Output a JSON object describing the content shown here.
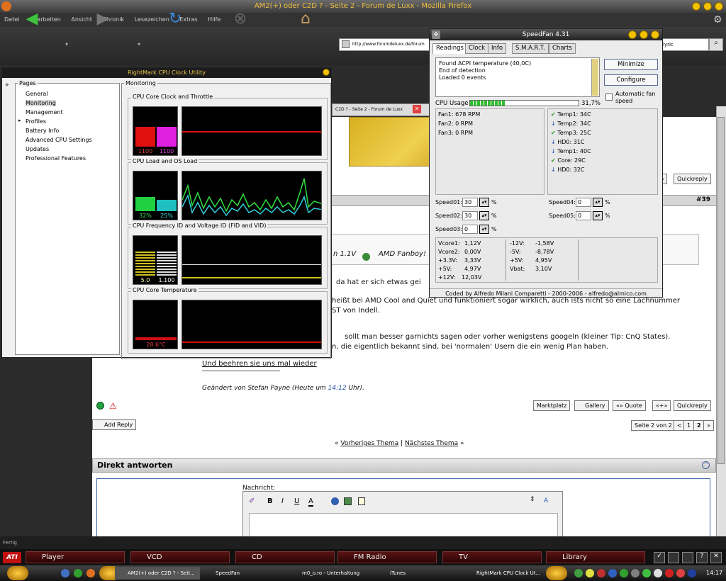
{
  "firefox": {
    "title": "AM2(+) oder C2D ? - Seite 2 - Forum de Luxx - Mozilla Firefox",
    "menu": [
      "Datei",
      "Bearbeiten",
      "Ansicht",
      "Chronik",
      "Lesezeichen",
      "Extras",
      "Hilfe"
    ],
    "url": "http://www.forumdeluxx.de/forum",
    "search_value": "lyric",
    "tab_title": "C2D ? - Seite 2 - Forum de Luxx",
    "status": "Fertig"
  },
  "forum": {
    "post_number": "#39",
    "buttons_top": [
      "Quickreply"
    ],
    "text_lines": [
      "n 1.1V",
      "AMD Fanboy!",
      "da hat er sich etwas gei",
      "heißt bei AMD Cool and Quiet und funktioniert sogar wirklich, auch ists nicht so eine Lachnummer",
      "ST von Indell.",
      "sollt man besser garnichts sagen oder vorher wenigstens googeln (kleiner Tip: CnQ States).",
      "n, die eigentlich bekannt sind, bei 'normalen' Usern die ein wenig Plan haben."
    ],
    "signature": "Und beehren sie uns mal wieder",
    "edited_prefix": "Geändert von Stefan Payne (Heute um ",
    "edited_time": "14:12",
    "edited_suffix": " Uhr).",
    "post_buttons": [
      "Marktplatz",
      "Gallery",
      "Quote",
      "Quickreply"
    ],
    "add_reply": "Add Reply",
    "pagination": {
      "label": "Seite 2 von 2",
      "prev": "<",
      "pages": [
        "1",
        "2"
      ]
    },
    "thread_nav": {
      "prev": "Vorheriges Thema",
      "sep": "|",
      "next": "Nächstes Thema"
    },
    "direct_reply": "Direkt antworten",
    "message_label": "Nachricht:"
  },
  "rightmark": {
    "title": "RightMark CPU Clock Utility",
    "pages_label": "Pages",
    "monitoring_label": "Monitoring",
    "nav": [
      "General",
      "Monitoring",
      "Management",
      "Profiles",
      "Battery Info",
      "Advanced CPU Settings",
      "Updates",
      "Professional Features"
    ],
    "groups": [
      {
        "label": "CPU Core Clock and Throttle",
        "values": [
          "1100",
          "1100"
        ],
        "colors": [
          "#e01010",
          "#e020e0"
        ],
        "fill": [
          0.45,
          0.45
        ]
      },
      {
        "label": "CPU Load and OS Load",
        "values": [
          "32%",
          "25%"
        ],
        "colors": [
          "#20d040",
          "#20c0c0"
        ],
        "fill": [
          0.32,
          0.25
        ]
      },
      {
        "label": "CPU Frequency ID and Voltage ID (FID and VID)",
        "values": [
          "5.0",
          "1.100"
        ],
        "colors": [
          "#d0c020",
          "#e0e0e0"
        ],
        "fill": [
          0.55,
          0.55
        ]
      },
      {
        "label": "CPU Core Temperature",
        "values": [
          "28.6°C"
        ],
        "colors": [
          "#d01010"
        ],
        "fill": [
          0.2
        ]
      }
    ]
  },
  "speedfan": {
    "title": "SpeedFan 4.31",
    "tabs": [
      "Readings",
      "Clock",
      "Info",
      "S.M.A.R.T.",
      "Charts"
    ],
    "log": [
      "Found ACPI temperature (40,0C)",
      "End of detection",
      "Loaded 0 events"
    ],
    "buttons": {
      "minimize": "Minimize",
      "configure": "Configure"
    },
    "auto_fan": "Automatic fan speed",
    "cpu_usage_label": "CPU Usage",
    "cpu_usage_value": "31,7%",
    "cpu_usage_fraction": 0.317,
    "fans": [
      "Fan1: 678 RPM",
      "Fan2: 0 RPM",
      "Fan3: 0 RPM"
    ],
    "temps": [
      {
        "label": "Temp1: 34C",
        "status": "check"
      },
      {
        "label": "Temp2: 34C",
        "status": "down"
      },
      {
        "label": "Temp3: 25C",
        "status": "check"
      },
      {
        "label": "HD0:   31C",
        "status": "down"
      },
      {
        "label": "Temp1: 40C",
        "status": "down"
      },
      {
        "label": "Core:  29C",
        "status": "check"
      },
      {
        "label": "HD0:   32C",
        "status": "down"
      }
    ],
    "speeds": [
      {
        "label": "Speed01:",
        "value": "30"
      },
      {
        "label": "Speed02:",
        "value": "30"
      },
      {
        "label": "Speed03:",
        "value": "0"
      },
      {
        "label": "Speed04:",
        "value": "0"
      },
      {
        "label": "Speed05:",
        "value": "0"
      }
    ],
    "percent": "%",
    "volts_left": [
      [
        "Vcore1:",
        "1,12V"
      ],
      [
        "Vcore2:",
        "0,00V"
      ],
      [
        "+3.3V:",
        "3,33V"
      ],
      [
        "+5V:",
        "4,97V"
      ],
      [
        "+12V:",
        "12,03V"
      ]
    ],
    "volts_right": [
      [
        "-12V:",
        "-1,58V"
      ],
      [
        "-5V:",
        "-8,78V"
      ],
      [
        "+5V:",
        "4,95V"
      ],
      [
        "Vbat:",
        "3,10V"
      ]
    ],
    "credits": "Coded by Alfredo Milani Comparetti - 2000-2006 - alfredo@almico.com"
  },
  "media_bar": {
    "logo": "ATI",
    "items": [
      "Player",
      "VCD",
      "CD",
      "FM Radio",
      "TV",
      "Library"
    ]
  },
  "taskbar": {
    "items": [
      "AM2(+) oder C2D ? - Seit...",
      "SpeedFan",
      "m0_o.ro - Unterhaltung",
      "iTunes",
      "RightMark CPU Clock Ut..."
    ],
    "clock": "14:17"
  }
}
